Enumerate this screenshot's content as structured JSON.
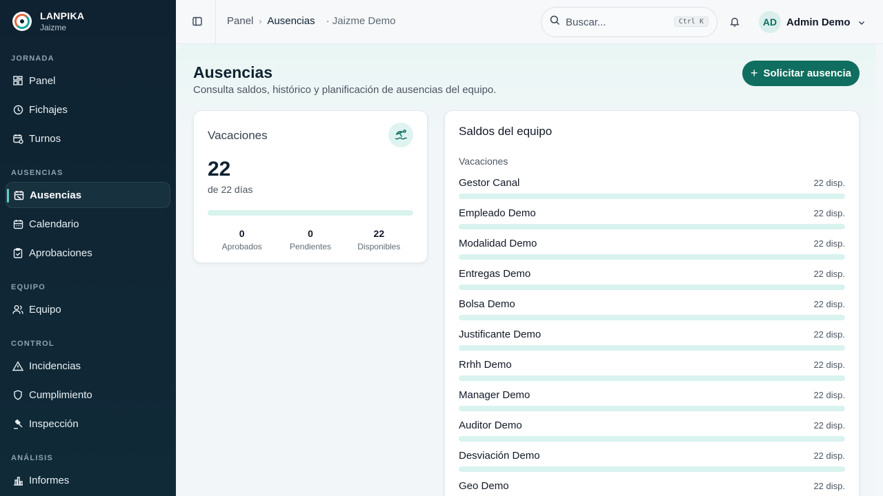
{
  "brand": {
    "name": "LANPIKA",
    "org": "Jaizme"
  },
  "sidebar": {
    "sections": [
      {
        "label": "JORNADA",
        "items": [
          {
            "label": "Panel",
            "icon": "dashboard-icon"
          },
          {
            "label": "Fichajes",
            "icon": "clock-icon"
          },
          {
            "label": "Turnos",
            "icon": "calendar-clock-icon"
          }
        ]
      },
      {
        "label": "AUSENCIAS",
        "items": [
          {
            "label": "Ausencias",
            "icon": "calendar-off-icon",
            "active": true
          },
          {
            "label": "Calendario",
            "icon": "calendar-icon"
          },
          {
            "label": "Aprobaciones",
            "icon": "clipboard-check-icon"
          }
        ]
      },
      {
        "label": "EQUIPO",
        "items": [
          {
            "label": "Equipo",
            "icon": "users-icon"
          }
        ]
      },
      {
        "label": "CONTROL",
        "items": [
          {
            "label": "Incidencias",
            "icon": "warning-icon"
          },
          {
            "label": "Cumplimiento",
            "icon": "shield-icon"
          },
          {
            "label": "Inspección",
            "icon": "gavel-icon"
          }
        ]
      },
      {
        "label": "ANÁLISIS",
        "items": [
          {
            "label": "Informes",
            "icon": "bar-chart-icon"
          }
        ]
      }
    ]
  },
  "topbar": {
    "breadcrumb": {
      "root": "Panel",
      "current": "Ausencias",
      "tenant": "· Jaizme Demo"
    },
    "search": {
      "placeholder": "Buscar...",
      "shortcut": "Ctrl K"
    },
    "user": {
      "initials": "AD",
      "name": "Admin Demo"
    }
  },
  "page": {
    "title": "Ausencias",
    "subtitle": "Consulta saldos, histórico y planificación de ausencias del equipo.",
    "primary_action": "Solicitar ausencia",
    "accent": "#0f6e5f"
  },
  "vacation_card": {
    "title": "Vacaciones",
    "available": "22",
    "of_text": "de 22 días",
    "used_fraction": 0,
    "stats": [
      {
        "value": "0",
        "label": "Aprobados"
      },
      {
        "value": "0",
        "label": "Pendientes"
      },
      {
        "value": "22",
        "label": "Disponibles"
      }
    ]
  },
  "team_balances": {
    "title": "Saldos del equipo",
    "group": "Vacaciones",
    "rows": [
      {
        "name": "Gestor Canal",
        "available": "22 disp.",
        "used_fraction": 0
      },
      {
        "name": "Empleado Demo",
        "available": "22 disp.",
        "used_fraction": 0
      },
      {
        "name": "Modalidad Demo",
        "available": "22 disp.",
        "used_fraction": 0
      },
      {
        "name": "Entregas Demo",
        "available": "22 disp.",
        "used_fraction": 0
      },
      {
        "name": "Bolsa Demo",
        "available": "22 disp.",
        "used_fraction": 0
      },
      {
        "name": "Justificante Demo",
        "available": "22 disp.",
        "used_fraction": 0
      },
      {
        "name": "Rrhh Demo",
        "available": "22 disp.",
        "used_fraction": 0
      },
      {
        "name": "Manager Demo",
        "available": "22 disp.",
        "used_fraction": 0
      },
      {
        "name": "Auditor Demo",
        "available": "22 disp.",
        "used_fraction": 0
      },
      {
        "name": "Desviación Demo",
        "available": "22 disp.",
        "used_fraction": 0
      },
      {
        "name": "Geo Demo",
        "available": "22 disp.",
        "used_fraction": 0
      }
    ]
  }
}
